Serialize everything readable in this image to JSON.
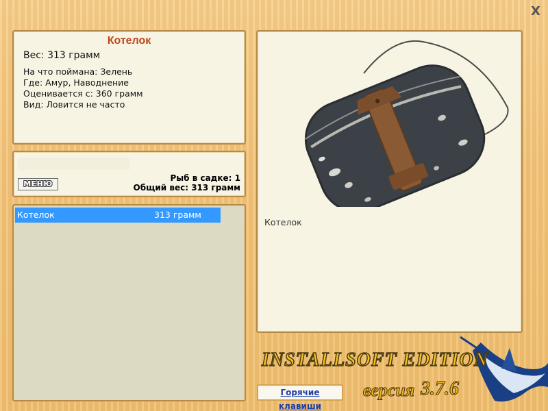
{
  "window": {
    "close_label": "X"
  },
  "info": {
    "title": "Котелок",
    "weight": "Вес: 313 грамм",
    "lines": [
      "На что поймана: Зелень",
      "Где: Амур, Наводнение",
      "Оценивается с: 360 грамм",
      "Вид: Ловится не часто"
    ]
  },
  "summary": {
    "menu_label": "МЕНЮ",
    "fish_count": "Рыб в садке: 1",
    "total_weight": "Общий вес: 313 грамм"
  },
  "catch_list": [
    {
      "name": "Котелок",
      "weight": "313 грамм"
    }
  ],
  "preview": {
    "caption": "Котелок",
    "image": "army-mess-tin"
  },
  "hotkeys_label": "Горячие клавиши",
  "branding": {
    "edition": "INSTALLSOFT EDITION",
    "version_prefix": "версия",
    "version_number": "3.7.6",
    "mascot": "marlin-fish"
  },
  "colors": {
    "background": "#f3c47a",
    "panel": "#f7f4e4",
    "list_panel": "#dcdac3",
    "selection": "#3399ff",
    "title": "#c0461b",
    "link": "#1f3fa8"
  }
}
